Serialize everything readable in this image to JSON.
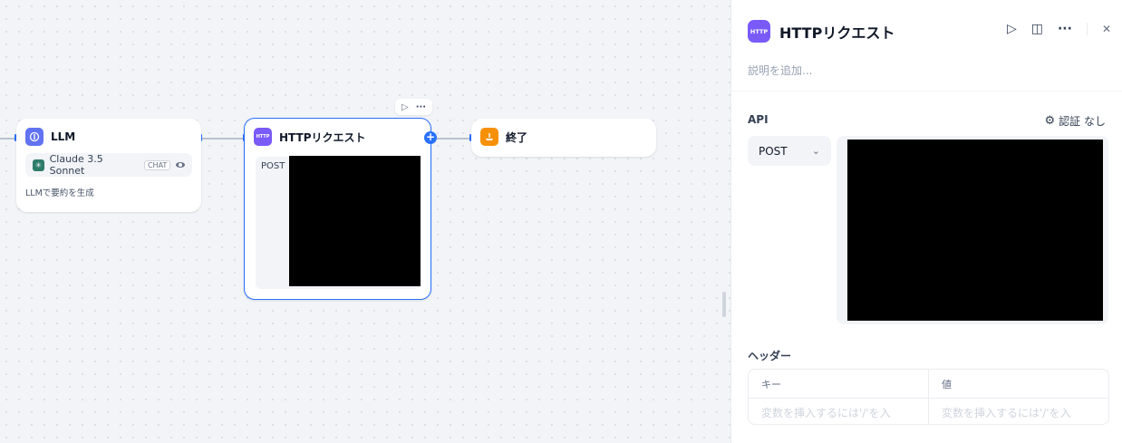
{
  "canvas": {
    "llm_node": {
      "title": "LLM",
      "icon": "llm-icon",
      "model_name": "Claude 3.5 Sonnet",
      "model_badge": "CHAT",
      "description": "LLMで要約を生成"
    },
    "http_node": {
      "title": "HTTPリクエスト",
      "icon_label": "HTTP",
      "method": "POST"
    },
    "end_node": {
      "title": "終了",
      "icon": "end-icon"
    },
    "toolbar": {
      "run_icon": "▷",
      "more_icon": "···"
    },
    "add_icon": "+"
  },
  "panel": {
    "icon_label": "HTTP",
    "title": "HTTPリクエスト",
    "tools": {
      "run": "▷",
      "docs": "◫",
      "more": "···",
      "close": "✕"
    },
    "description_placeholder": "説明を追加...",
    "api_label": "API",
    "auth_label": "認証 なし",
    "auth_icon": "⚙",
    "method": "POST",
    "method_chevron": "⌄",
    "headers_label": "ヘッダー",
    "headers_table": {
      "key_header": "キー",
      "value_header": "値",
      "key_placeholder": "変数を挿入するには'/'を入",
      "value_placeholder": "変数を挿入するには'/'を入"
    }
  },
  "colors": {
    "accent": "#2970ff",
    "llm_icon": "#6172f3",
    "http_icon": "#7a5af8",
    "end_icon": "#f79009"
  }
}
